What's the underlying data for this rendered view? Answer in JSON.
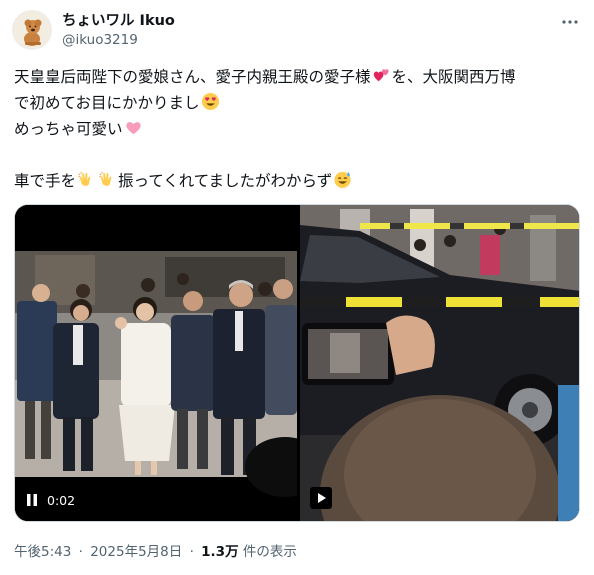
{
  "author": {
    "display_name": "ちょいワル Ikuo",
    "handle": "@ikuo3219",
    "avatar_icon": "poodle-avatar-icon"
  },
  "more_icon": "more-options-icon",
  "tweet_text": {
    "line1_a": "天皇皇后両陛下の愛娘さん、愛子内親王殿の愛子様",
    "line1_b": "を、大阪関西万博",
    "line2_a": "で初めてお目にかかりまし",
    "line3_a": "めっちゃ可愛い",
    "line4_a": "車で手を",
    "line4_b": "振ってくれてましたがわからず"
  },
  "emojis": {
    "two_hearts": "two-hearts-emoji",
    "heart_eyes": "heart-eyes-emoji",
    "pink_heart": "pink-heart-emoji",
    "clap": "clapping-hands-emoji",
    "sweat_smile": "sweat-smile-emoji"
  },
  "media": {
    "video1": {
      "duration": "0:02",
      "control_icon": "pause-icon"
    },
    "video2": {
      "control_icon": "play-icon"
    }
  },
  "meta": {
    "time": "午後5:43",
    "date": "2025年5月8日",
    "views": "1.3万",
    "views_label": "件の表示",
    "separator": "·"
  },
  "colors": {
    "text": "#0f1419",
    "secondary": "#536471",
    "border": "#cfd9de",
    "accent_pink": "#f36f9a"
  }
}
